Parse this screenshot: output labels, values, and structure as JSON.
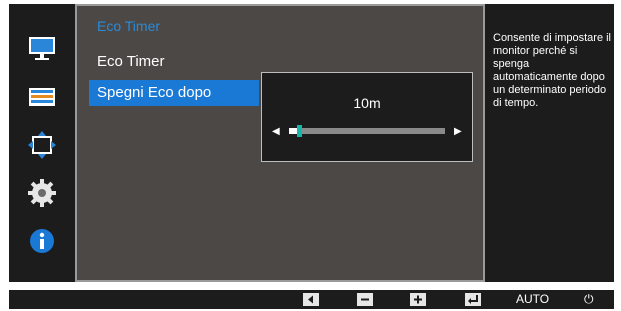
{
  "menu": {
    "title": "Eco Timer",
    "items": [
      {
        "label": "Eco Timer",
        "selected": false
      },
      {
        "label": "Spegni Eco dopo",
        "selected": true
      }
    ]
  },
  "sidebar": {
    "icons": [
      "monitor-icon",
      "picture-settings-icon",
      "screen-size-icon",
      "gear-icon",
      "info-icon"
    ]
  },
  "popup": {
    "value_label": "10m",
    "slider_level_percent": 5,
    "left_arrow": "◀",
    "right_arrow": "▶"
  },
  "help": {
    "text": "Consente di impostare il monitor perché si spenga automaticamente dopo un determinato periodo di tempo."
  },
  "bottombar": {
    "buttons": [
      "left-arrow-icon",
      "minus-icon",
      "plus-icon",
      "enter-icon"
    ],
    "auto_label": "AUTO",
    "power_glyph": "⏻"
  },
  "colors": {
    "accent_blue": "#1b79d6",
    "title_blue": "#2a8bd9",
    "thumb_teal": "#17b6a8",
    "panel_gray": "#4c4845"
  }
}
